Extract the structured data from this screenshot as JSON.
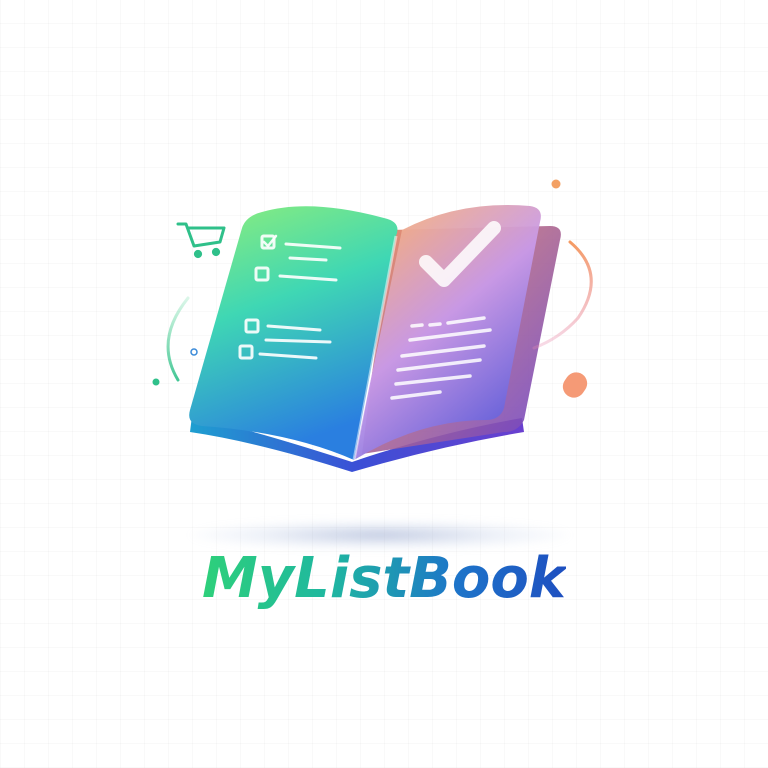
{
  "brand": {
    "name": "MyListBook",
    "icon": "open-book-checklist-icon",
    "colors": {
      "gradient_start": "#2ed07a",
      "gradient_mid": "#1d74c9",
      "gradient_end": "#1e4fc0",
      "accent_orange": "#f39a5a",
      "accent_purple": "#7b5be0"
    },
    "decorations": [
      "shopping-cart-icon",
      "check-mark-icon",
      "orbit-arc",
      "sparkle-dots"
    ]
  }
}
